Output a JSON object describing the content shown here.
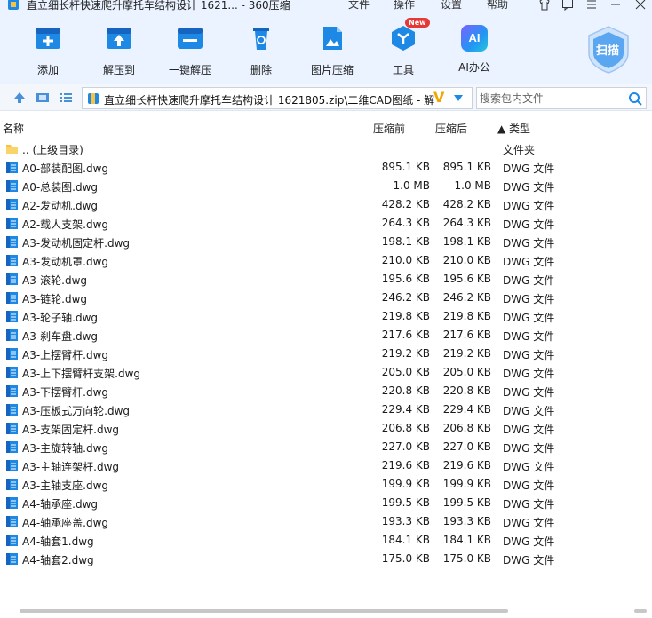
{
  "window": {
    "title": "直立细长杆快速爬升摩托车结构设计 1621... - 360压缩",
    "menus": [
      "文件",
      "操作",
      "设置",
      "帮助"
    ]
  },
  "toolbar": {
    "items": [
      {
        "label": "添加",
        "icon": "add-icon"
      },
      {
        "label": "解压到",
        "icon": "extract-to-icon"
      },
      {
        "label": "一键解压",
        "icon": "one-click-extract-icon"
      },
      {
        "label": "删除",
        "icon": "delete-icon"
      },
      {
        "label": "图片压缩",
        "icon": "image-compress-icon"
      },
      {
        "label": "工具",
        "icon": "tools-icon"
      },
      {
        "label": "AI办公",
        "icon": "ai-office-icon"
      }
    ],
    "ai_badge": "AI",
    "new_badge": "New",
    "scan_label": "扫描"
  },
  "address": {
    "path": "直立细长杆快速爬升摩托车结构设计 1621805.zip\\二维CAD图纸 - 解"
  },
  "search": {
    "placeholder": "搜索包内文件"
  },
  "columns": {
    "name": "名称",
    "before": "压缩前",
    "after": "压缩后",
    "type": "▲ 类型"
  },
  "files": [
    {
      "name": ".. (上级目录)",
      "before": "",
      "after": "",
      "type": "文件夹",
      "kind": "folder"
    },
    {
      "name": "A0-部装配图.dwg",
      "before": "895.1 KB",
      "after": "895.1 KB",
      "type": "DWG 文件",
      "kind": "dwg"
    },
    {
      "name": "A0-总装图.dwg",
      "before": "1.0 MB",
      "after": "1.0 MB",
      "type": "DWG 文件",
      "kind": "dwg"
    },
    {
      "name": "A2-发动机.dwg",
      "before": "428.2 KB",
      "after": "428.2 KB",
      "type": "DWG 文件",
      "kind": "dwg"
    },
    {
      "name": "A2-载人支架.dwg",
      "before": "264.3 KB",
      "after": "264.3 KB",
      "type": "DWG 文件",
      "kind": "dwg"
    },
    {
      "name": "A3-发动机固定杆.dwg",
      "before": "198.1 KB",
      "after": "198.1 KB",
      "type": "DWG 文件",
      "kind": "dwg"
    },
    {
      "name": "A3-发动机罩.dwg",
      "before": "210.0 KB",
      "after": "210.0 KB",
      "type": "DWG 文件",
      "kind": "dwg"
    },
    {
      "name": "A3-滚轮.dwg",
      "before": "195.6 KB",
      "after": "195.6 KB",
      "type": "DWG 文件",
      "kind": "dwg"
    },
    {
      "name": "A3-链轮.dwg",
      "before": "246.2 KB",
      "after": "246.2 KB",
      "type": "DWG 文件",
      "kind": "dwg"
    },
    {
      "name": "A3-轮子轴.dwg",
      "before": "219.8 KB",
      "after": "219.8 KB",
      "type": "DWG 文件",
      "kind": "dwg"
    },
    {
      "name": "A3-刹车盘.dwg",
      "before": "217.6 KB",
      "after": "217.6 KB",
      "type": "DWG 文件",
      "kind": "dwg"
    },
    {
      "name": "A3-上摆臂杆.dwg",
      "before": "219.2 KB",
      "after": "219.2 KB",
      "type": "DWG 文件",
      "kind": "dwg"
    },
    {
      "name": "A3-上下摆臂杆支架.dwg",
      "before": "205.0 KB",
      "after": "205.0 KB",
      "type": "DWG 文件",
      "kind": "dwg"
    },
    {
      "name": "A3-下摆臂杆.dwg",
      "before": "220.8 KB",
      "after": "220.8 KB",
      "type": "DWG 文件",
      "kind": "dwg"
    },
    {
      "name": "A3-压板式万向轮.dwg",
      "before": "229.4 KB",
      "after": "229.4 KB",
      "type": "DWG 文件",
      "kind": "dwg"
    },
    {
      "name": "A3-支架固定杆.dwg",
      "before": "206.8 KB",
      "after": "206.8 KB",
      "type": "DWG 文件",
      "kind": "dwg"
    },
    {
      "name": "A3-主旋转轴.dwg",
      "before": "227.0 KB",
      "after": "227.0 KB",
      "type": "DWG 文件",
      "kind": "dwg"
    },
    {
      "name": "A3-主轴连架杆.dwg",
      "before": "219.6 KB",
      "after": "219.6 KB",
      "type": "DWG 文件",
      "kind": "dwg"
    },
    {
      "name": "A3-主轴支座.dwg",
      "before": "199.9 KB",
      "after": "199.9 KB",
      "type": "DWG 文件",
      "kind": "dwg"
    },
    {
      "name": "A4-轴承座.dwg",
      "before": "199.5 KB",
      "after": "199.5 KB",
      "type": "DWG 文件",
      "kind": "dwg"
    },
    {
      "name": "A4-轴承座盖.dwg",
      "before": "193.3 KB",
      "after": "193.3 KB",
      "type": "DWG 文件",
      "kind": "dwg"
    },
    {
      "name": "A4-轴套1.dwg",
      "before": "184.1 KB",
      "after": "184.1 KB",
      "type": "DWG 文件",
      "kind": "dwg"
    },
    {
      "name": "A4-轴套2.dwg",
      "before": "175.0 KB",
      "after": "175.0 KB",
      "type": "DWG 文件",
      "kind": "dwg"
    }
  ],
  "colors": {
    "accent": "#1e88e5",
    "toolbar_bg": "#eaf3ff",
    "folder": "#f6c343",
    "vip": "#f2a600"
  }
}
